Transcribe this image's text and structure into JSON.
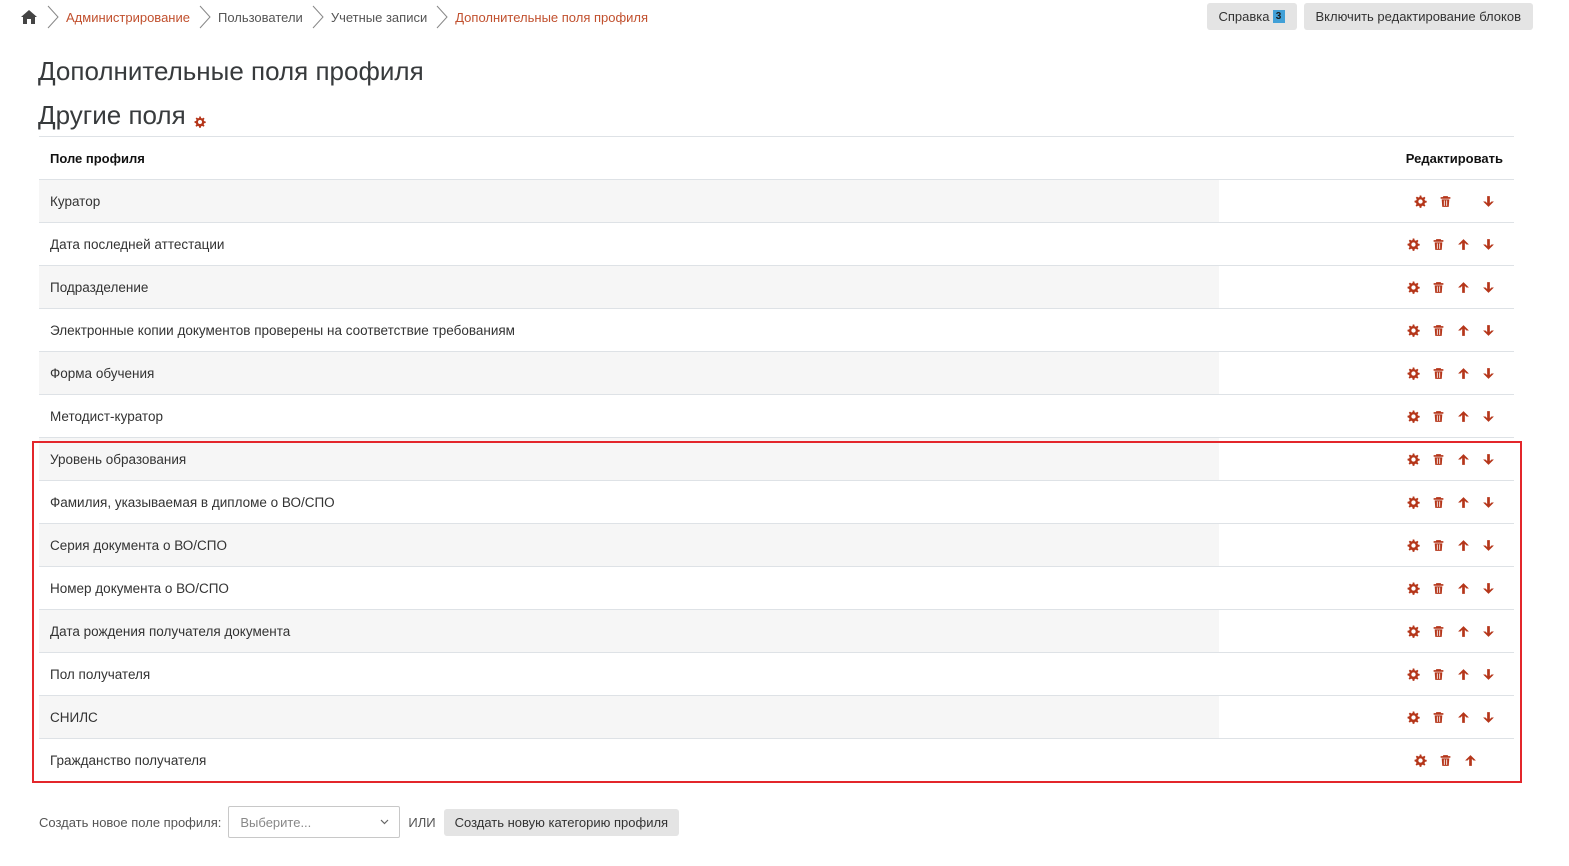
{
  "breadcrumb": {
    "home_icon": "home-icon",
    "items": [
      "Администрирование",
      "Пользователи",
      "Учетные записи"
    ],
    "current": "Дополнительные поля профиля"
  },
  "top_buttons": {
    "help_label": "Справка",
    "help_count": "3",
    "edit_blocks_label": "Включить редактирование блоков"
  },
  "page": {
    "title": "Дополнительные поля профиля",
    "category": "Другие поля"
  },
  "table": {
    "headers": {
      "field": "Поле профиля",
      "edit": "Редактировать"
    },
    "rows": [
      "Куратор",
      "Дата последней аттестации",
      "Подразделение",
      "Электронные копии документов проверены на соответствие требованиям",
      "Форма обучения",
      "Методист-куратор",
      "Уровень образования",
      "Фамилия, указываемая в дипломе о ВО/СПО",
      "Серия документа о ВО/СПО",
      "Номер документа о ВО/СПО",
      "Дата рождения получателя документа",
      "Пол получателя",
      "СНИЛС",
      "Гражданство получателя"
    ]
  },
  "bottom": {
    "create_field_label": "Создать новое поле профиля:",
    "select_placeholder": "Выберите...",
    "or_label": "ИЛИ",
    "create_category_label": "Создать новую категорию профиля"
  },
  "colors": {
    "accent": "#c1502e",
    "icon": "#b5361a",
    "highlight": "#e3262b"
  }
}
